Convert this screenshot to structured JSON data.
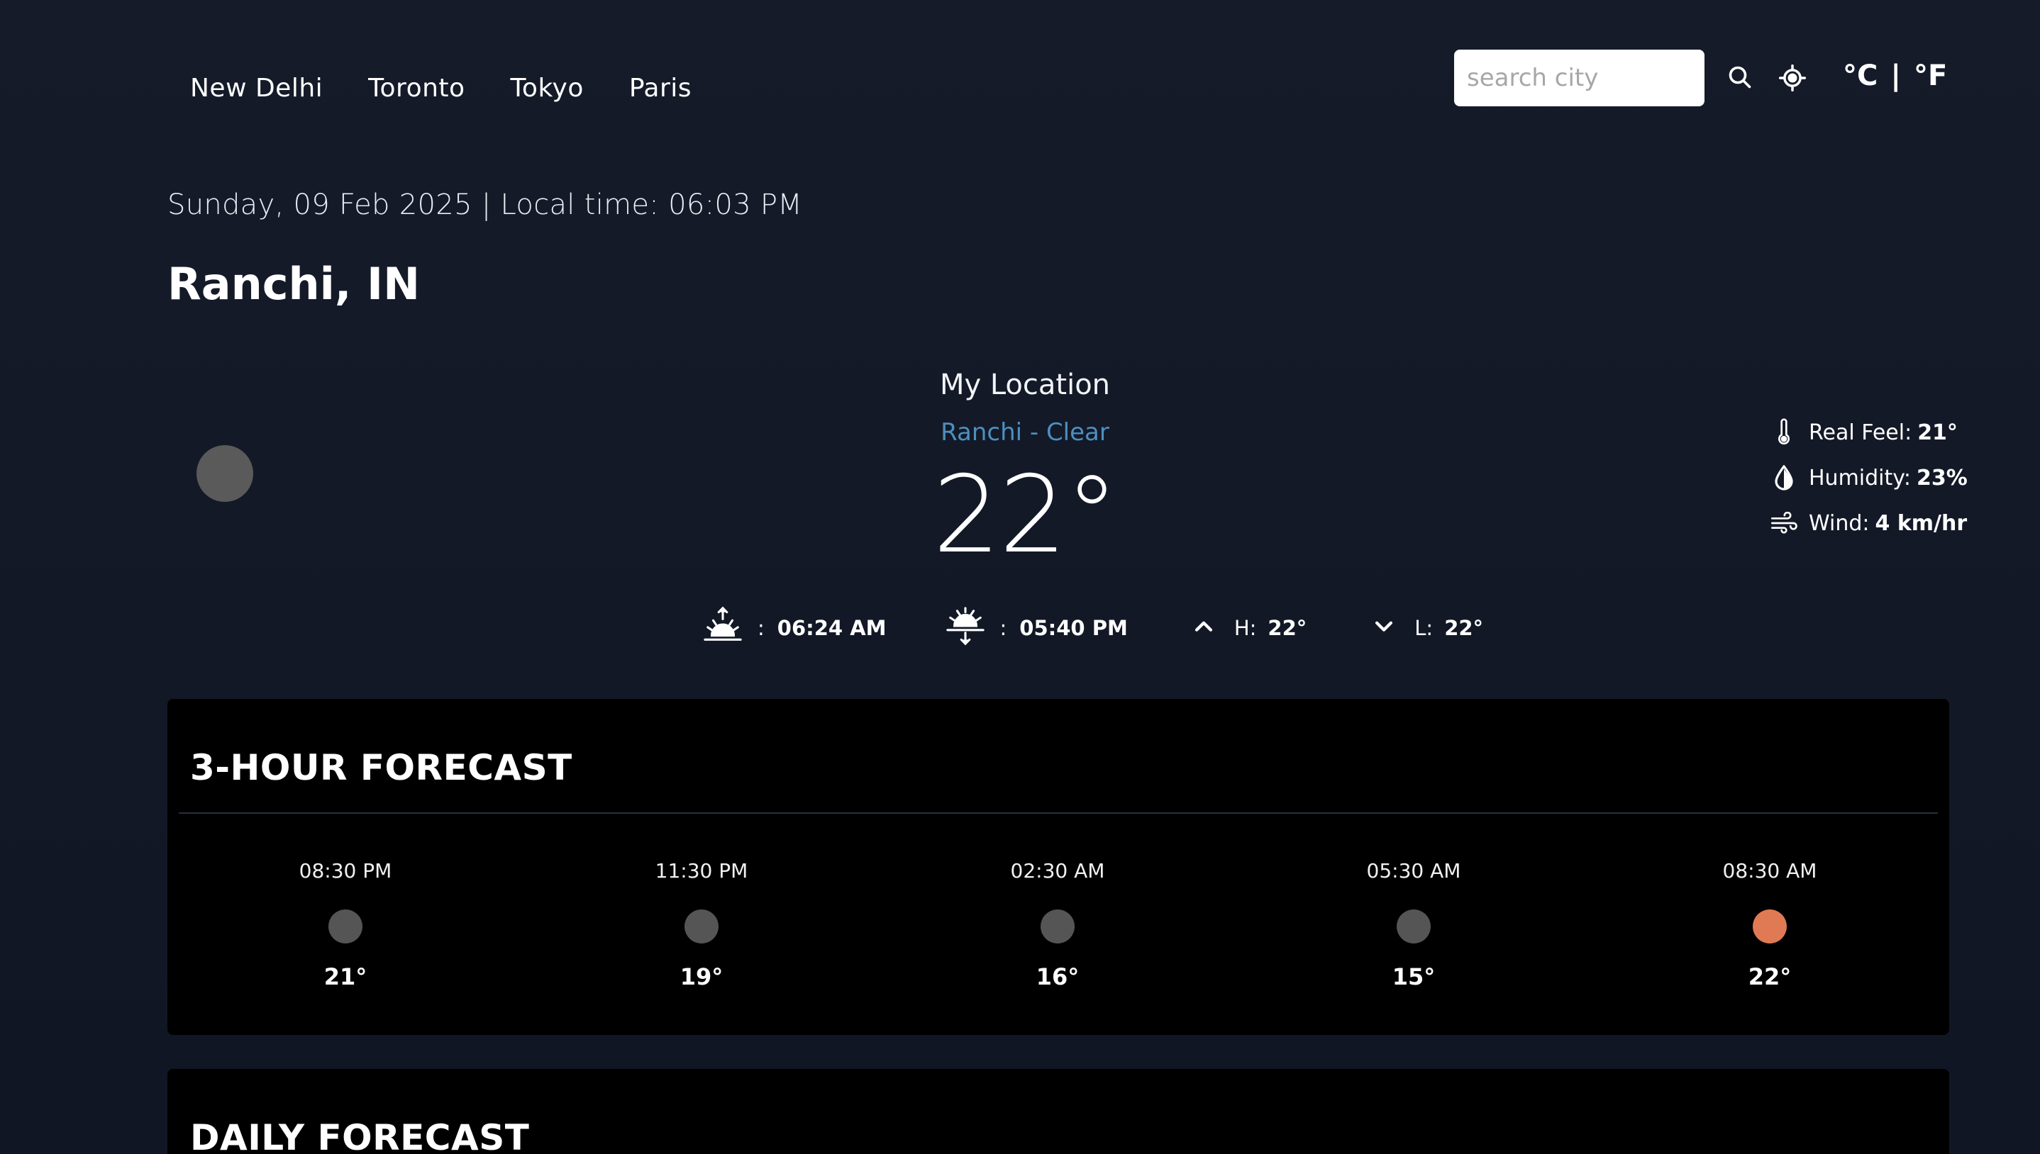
{
  "nav": {
    "cities": [
      "New Delhi",
      "Toronto",
      "Tokyo",
      "Paris"
    ],
    "search_placeholder": "search city",
    "unit_c": "°C",
    "unit_sep": "|",
    "unit_f": "°F"
  },
  "header": {
    "datetime": "Sunday, 09 Feb 2025 | Local time: 06:03 PM",
    "place": "Ranchi, IN"
  },
  "current": {
    "heading": "My Location",
    "condition": "Ranchi - Clear",
    "temp": "22°",
    "icon": "moon-icon",
    "details": [
      {
        "icon": "thermometer-icon",
        "label": "Real Feel:",
        "value": "21°"
      },
      {
        "icon": "humidity-icon",
        "label": "Humidity:",
        "value": "23%"
      },
      {
        "icon": "wind-icon",
        "label": "Wind:",
        "value": "4 km/hr"
      }
    ],
    "sunrise": {
      "icon": "sunrise-icon",
      "sep": ":",
      "value": "06:24 AM"
    },
    "sunset": {
      "icon": "sunset-icon",
      "sep": ":",
      "value": "05:40 PM"
    },
    "high": {
      "icon": "chevron-up-icon",
      "label": "H:",
      "value": "22°"
    },
    "low": {
      "icon": "chevron-down-icon",
      "label": "L:",
      "value": "22°"
    }
  },
  "hourly": {
    "title": "3-HOUR FORECAST",
    "items": [
      {
        "time": "08:30 PM",
        "temp": "21°",
        "icon_color": "#555555"
      },
      {
        "time": "11:30 PM",
        "temp": "19°",
        "icon_color": "#555555"
      },
      {
        "time": "02:30 AM",
        "temp": "16°",
        "icon_color": "#555555"
      },
      {
        "time": "05:30 AM",
        "temp": "15°",
        "icon_color": "#555555"
      },
      {
        "time": "08:30 AM",
        "temp": "22°",
        "icon_color": "#e07a55"
      }
    ]
  },
  "daily": {
    "title": "DAILY FORECAST"
  },
  "colors": {
    "background": "#121826",
    "accent_condition": "#4d8fbf",
    "sun_icon": "#e07a55"
  }
}
